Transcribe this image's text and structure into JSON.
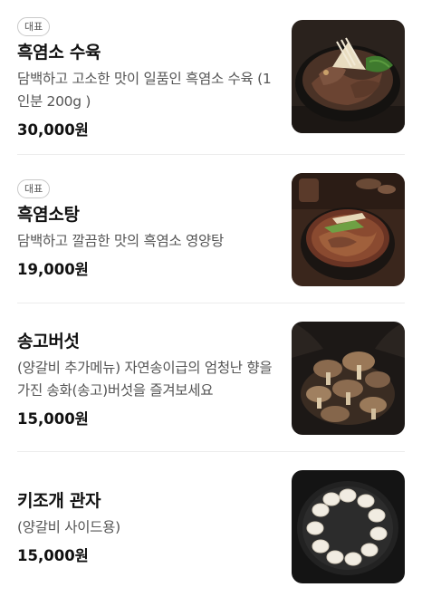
{
  "menu": {
    "items": [
      {
        "badge": "대표",
        "name": "흑염소 수육",
        "description": "담백하고 고소한 맛이 일품인 흑염소 수육 (1인분 200g )",
        "price": "30,000원",
        "image_icon": "black-goat-suyuk-photo"
      },
      {
        "badge": "대표",
        "name": "흑염소탕",
        "description": "담백하고 깔끔한 맛의 흑염소 영양탕",
        "price": "19,000원",
        "image_icon": "black-goat-soup-photo"
      },
      {
        "name": "송고버섯",
        "description": "(양갈비 추가메뉴) 자연송이급의 엄청난 향을 가진 송화(송고)버섯을 즐겨보세요",
        "price": "15,000원",
        "image_icon": "songgo-mushroom-photo"
      },
      {
        "name": "키조개 관자",
        "description": "(양갈비 사이드용)",
        "price": "15,000원",
        "image_icon": "pen-shell-scallop-photo"
      }
    ]
  }
}
